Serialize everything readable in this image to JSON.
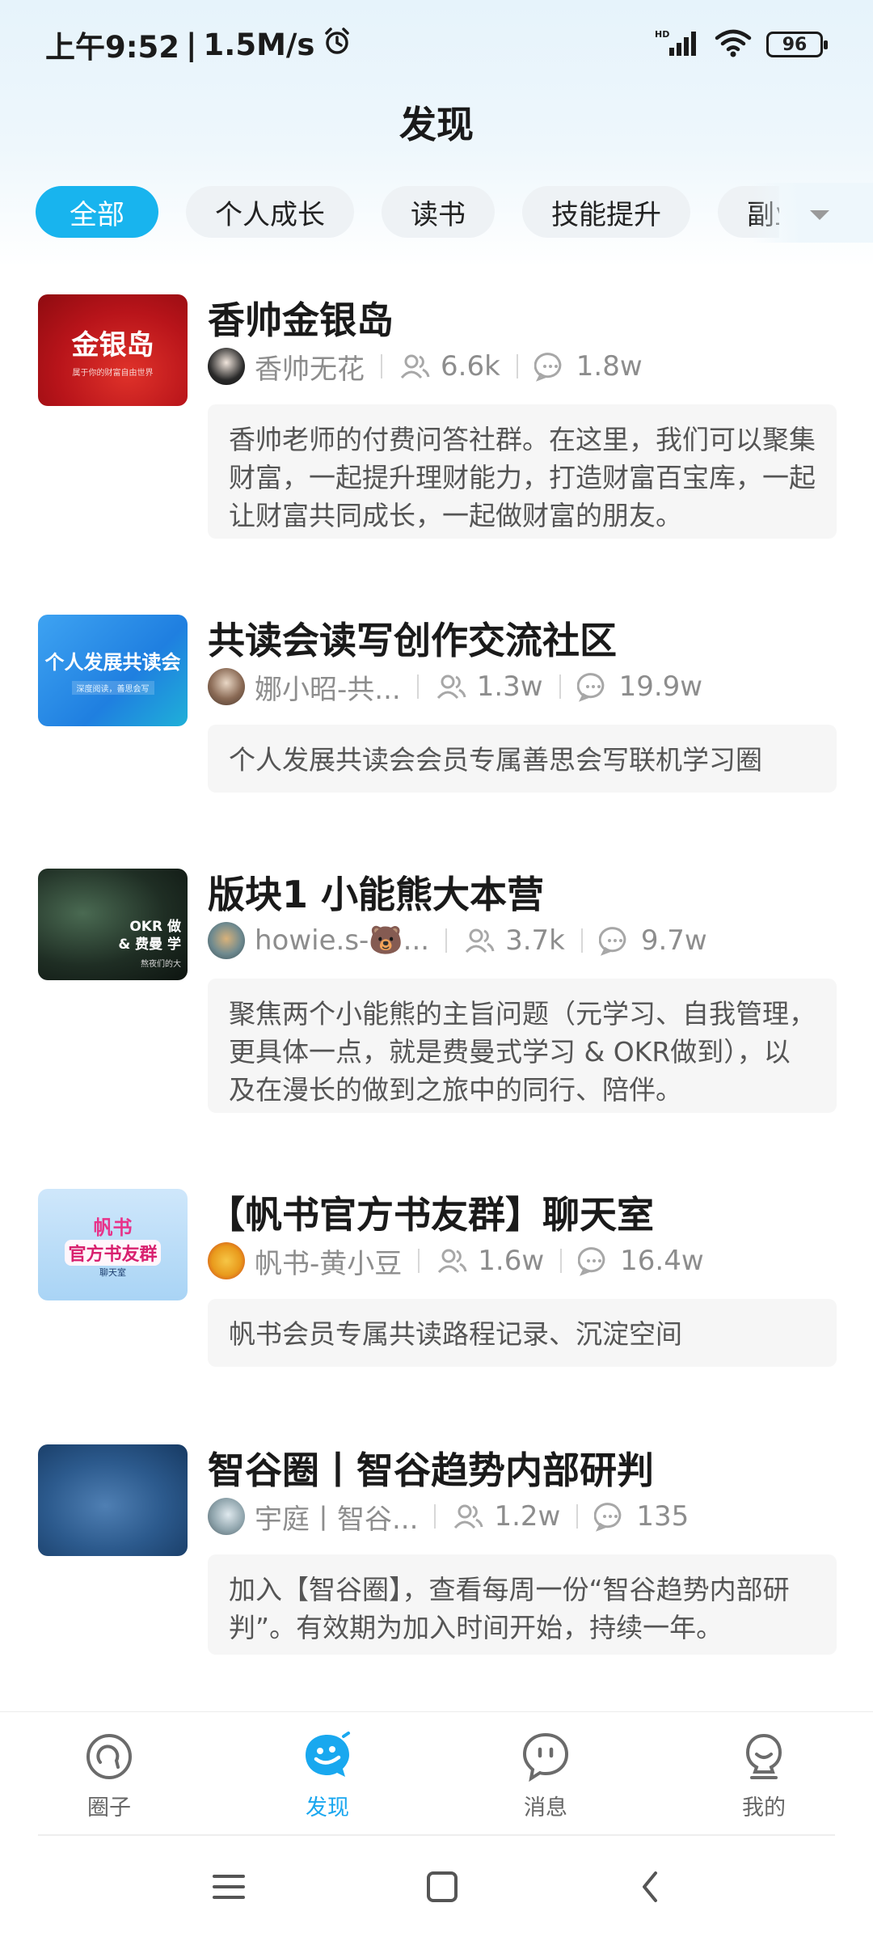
{
  "status_bar": {
    "time": "上午9:52",
    "speed": "1.5M/s",
    "battery": "96",
    "network_label": "HD"
  },
  "header": {
    "title": "发现"
  },
  "tabs": [
    {
      "label": "全部",
      "active": true
    },
    {
      "label": "个人成长",
      "active": false
    },
    {
      "label": "读书",
      "active": false
    },
    {
      "label": "技能提升",
      "active": false
    },
    {
      "label": "副业",
      "active": false
    }
  ],
  "cards": [
    {
      "title": "香帅金银岛",
      "author": "香帅无花",
      "members": "6.6k",
      "posts": "1.8w",
      "description": "香帅老师的付费问答社群。在这里，我们可以聚集财富，一起提升理财能力，打造财富百宝库，一起让财富共同成长，一起做财富的朋友。",
      "thumb_text": "金银岛",
      "thumb_sub": "属于你的财富自由世界"
    },
    {
      "title": "共读会读写创作交流社区",
      "author": "娜小昭-共...",
      "members": "1.3w",
      "posts": "19.9w",
      "description": "个人发展共读会会员专属善思会写联机学习圈",
      "thumb_text": "个人发展共读会",
      "thumb_sub": "深度阅读，善思会写"
    },
    {
      "title": "版块1 小能熊大本营",
      "author": "howie.s-🐻...",
      "members": "3.7k",
      "posts": "9.7w",
      "description": "聚焦两个小能熊的主旨问题（元学习、自我管理，更具体一点，就是费曼式学习 & OKR做到），以及在漫长的做到之旅中的同行、陪伴。",
      "thumb_text": "OKR 做\n& 费曼 学",
      "thumb_sub": "熬夜们的大"
    },
    {
      "title": "【帆书官方书友群】聊天室",
      "author": "帆书-黄小豆",
      "members": "1.6w",
      "posts": "16.4w",
      "description": "帆书会员专属共读路程记录、沉淀空间",
      "thumb_text": "帆书",
      "thumb_sub": "官方书友群",
      "thumb_sub2": "聊天室"
    },
    {
      "title": "智谷圈丨智谷趋势内部研判",
      "author": "宇庭丨智谷...",
      "members": "1.2w",
      "posts": "135",
      "description": "加入【智谷圈】，查看每周一份“智谷趋势内部研判”。有效期为加入时间开始，持续一年。"
    }
  ],
  "bottom_nav": [
    {
      "label": "圈子",
      "icon": "circle-icon",
      "active": false
    },
    {
      "label": "发现",
      "icon": "discover-icon",
      "active": true
    },
    {
      "label": "消息",
      "icon": "message-icon",
      "active": false
    },
    {
      "label": "我的",
      "icon": "profile-icon",
      "active": false
    }
  ],
  "colors": {
    "accent": "#18b4ee",
    "text_primary": "#1a1a1a",
    "text_secondary": "#8d8d8d",
    "desc_bg": "#f6f6f6"
  }
}
